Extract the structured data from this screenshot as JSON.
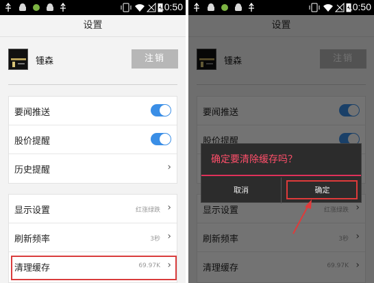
{
  "status_bar": {
    "time": "10:50"
  },
  "header": {
    "title": "设置"
  },
  "account": {
    "username": "锺森",
    "logout_label": "注销"
  },
  "group1": [
    {
      "label": "要闻推送",
      "type": "toggle",
      "on": true
    },
    {
      "label": "股价提醒",
      "type": "toggle",
      "on": true
    },
    {
      "label": "历史提醒",
      "type": "link"
    }
  ],
  "group2": [
    {
      "label": "显示设置",
      "value": "红涨绿跌"
    },
    {
      "label": "刷新频率",
      "value": "3秒"
    },
    {
      "label": "清理缓存",
      "value": "69.97K"
    }
  ],
  "dialog": {
    "title": "确定要清除缓存吗？",
    "cancel_label": "取消",
    "confirm_label": "确定"
  },
  "colors": {
    "toggle_on": "#3a8ee6",
    "highlight": "#d93b3b",
    "dialog_accent": "#e0315a",
    "dialog_title": "#ff4f6a"
  },
  "icons": [
    "usb-icon",
    "android-icon",
    "android-icon",
    "usb-icon",
    "vibrate-icon",
    "wifi-icon",
    "no-signal-icon",
    "battery-charging-icon"
  ]
}
